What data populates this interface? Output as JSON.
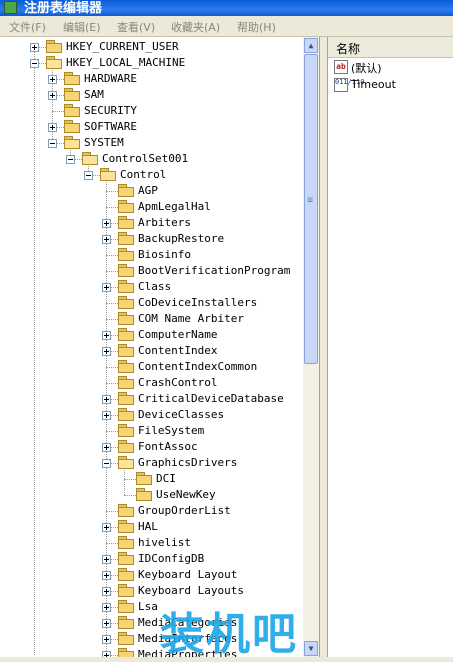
{
  "window": {
    "title": "注册表编辑器"
  },
  "menu": [
    {
      "label": "文件(F)"
    },
    {
      "label": "编辑(E)"
    },
    {
      "label": "查看(V)"
    },
    {
      "label": "收藏夹(A)"
    },
    {
      "label": "帮助(H)"
    }
  ],
  "tree": {
    "nodes": [
      {
        "label": "HKEY_CURRENT_USER",
        "expander": "plus"
      },
      {
        "label": "HKEY_LOCAL_MACHINE",
        "expander": "minus"
      },
      {
        "label": "HARDWARE",
        "expander": "plus"
      },
      {
        "label": "SAM",
        "expander": "plus"
      },
      {
        "label": "SECURITY",
        "expander": "none"
      },
      {
        "label": "SOFTWARE",
        "expander": "plus"
      },
      {
        "label": "SYSTEM",
        "expander": "minus"
      },
      {
        "label": "ControlSet001",
        "expander": "minus"
      },
      {
        "label": "Control",
        "expander": "minus"
      },
      {
        "label": "AGP",
        "expander": "none"
      },
      {
        "label": "ApmLegalHal",
        "expander": "none"
      },
      {
        "label": "Arbiters",
        "expander": "plus"
      },
      {
        "label": "BackupRestore",
        "expander": "plus"
      },
      {
        "label": "Biosinfo",
        "expander": "none"
      },
      {
        "label": "BootVerificationProgram",
        "expander": "none"
      },
      {
        "label": "Class",
        "expander": "plus"
      },
      {
        "label": "CoDeviceInstallers",
        "expander": "none"
      },
      {
        "label": "COM Name Arbiter",
        "expander": "none"
      },
      {
        "label": "ComputerName",
        "expander": "plus"
      },
      {
        "label": "ContentIndex",
        "expander": "plus"
      },
      {
        "label": "ContentIndexCommon",
        "expander": "none"
      },
      {
        "label": "CrashControl",
        "expander": "none"
      },
      {
        "label": "CriticalDeviceDatabase",
        "expander": "plus"
      },
      {
        "label": "DeviceClasses",
        "expander": "plus"
      },
      {
        "label": "FileSystem",
        "expander": "none"
      },
      {
        "label": "FontAssoc",
        "expander": "plus"
      },
      {
        "label": "GraphicsDrivers",
        "expander": "minus"
      },
      {
        "label": "DCI",
        "expander": "none"
      },
      {
        "label": "UseNewKey",
        "expander": "none"
      },
      {
        "label": "GroupOrderList",
        "expander": "none"
      },
      {
        "label": "HAL",
        "expander": "plus"
      },
      {
        "label": "hivelist",
        "expander": "none"
      },
      {
        "label": "IDConfigDB",
        "expander": "plus"
      },
      {
        "label": "Keyboard Layout",
        "expander": "plus"
      },
      {
        "label": "Keyboard Layouts",
        "expander": "plus"
      },
      {
        "label": "Lsa",
        "expander": "plus"
      },
      {
        "label": "MediaCategories",
        "expander": "plus"
      },
      {
        "label": "MediaInterfaces",
        "expander": "plus"
      },
      {
        "label": "MediaProperties",
        "expander": "plus"
      }
    ]
  },
  "values": {
    "column_header": "名称",
    "items": [
      {
        "name": "(默认)",
        "type_icon": "ab"
      },
      {
        "name": "Timeout",
        "type_icon": "011/110"
      }
    ]
  },
  "watermark": {
    "text": "装机吧"
  },
  "colors": {
    "titlebar": "#0a5ad6",
    "folder": "#f6d576",
    "watermark": "#1aa6e8"
  }
}
